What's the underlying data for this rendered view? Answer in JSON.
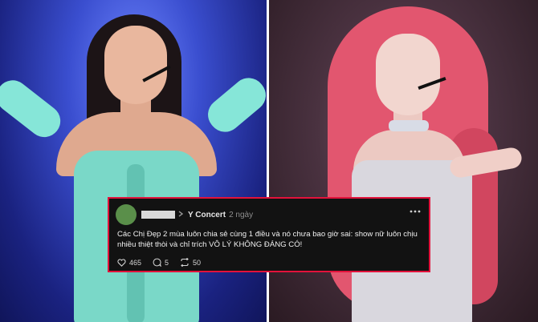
{
  "post": {
    "group_name": "Y Concert",
    "time_ago": "2 ngày",
    "text": "Các Chị Đẹp 2 mùa luôn chia sẻ cùng 1 điều và nó chưa bao giờ sai: show nữ luôn chịu nhiều thiệt thòi và chỉ trích VÔ LÝ KHÔNG ĐÁNG CÓ!",
    "likes": "465",
    "comments": "5",
    "shares": "50",
    "more_icon": "ellipsis-icon",
    "chevron_icon": "chevron-right-icon"
  },
  "colors": {
    "card_border": "#e2123b",
    "card_background": "#121212"
  }
}
